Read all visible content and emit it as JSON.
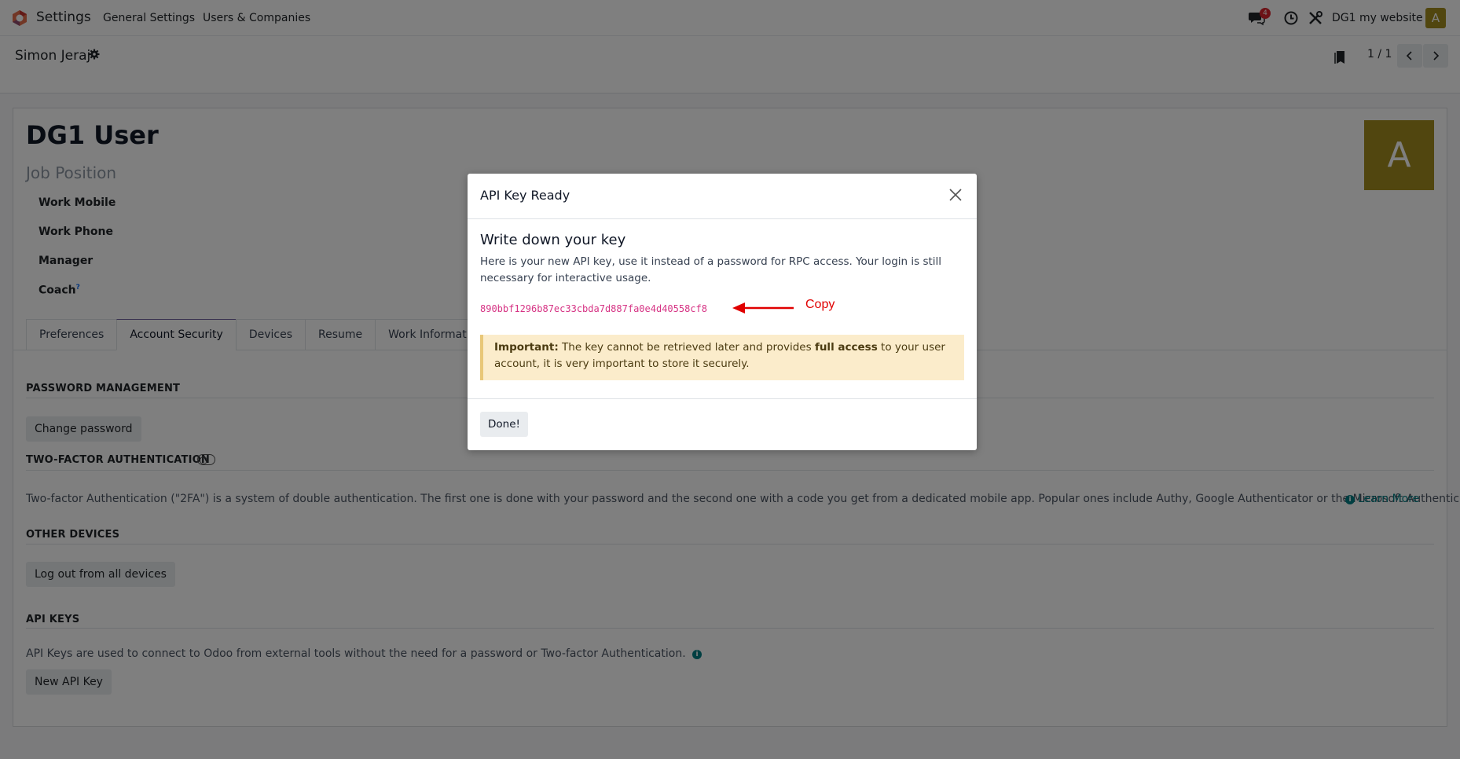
{
  "navbar": {
    "app_name": "Settings",
    "menu": [
      "General Settings",
      "Users & Companies"
    ],
    "chat_badge": "4",
    "company": "DG1 my website",
    "avatar_letter": "A"
  },
  "control_panel": {
    "breadcrumb": "Simon Jeraj",
    "pager": "1 / 1"
  },
  "form": {
    "title": "DG1 User",
    "job_position_placeholder": "Job Position",
    "fields": [
      "Work Mobile",
      "Work Phone",
      "Manager",
      "Coach"
    ],
    "coach_help": "?",
    "avatar_letter": "A",
    "tabs": [
      "Preferences",
      "Account Security",
      "Devices",
      "Resume",
      "Work Information"
    ],
    "active_tab": "Account Security",
    "sections": {
      "password": {
        "title": "PASSWORD MANAGEMENT",
        "button": "Change password"
      },
      "twofa": {
        "title": "TWO-FACTOR AUTHENTICATION",
        "description": "Two-factor Authentication (\"2FA\") is a system of double authentication. The first one is done with your password and the second one with a code you get from a dedicated mobile app. Popular ones include Authy, Google Authenticator or the Microsoft Authenticator.",
        "learn_more": "Learn More"
      },
      "devices": {
        "title": "OTHER DEVICES",
        "button": "Log out from all devices"
      },
      "api_keys": {
        "title": "API KEYS",
        "description": "API Keys are used to connect to Odoo from external tools without the need for a password or Two-factor Authentication.",
        "button": "New API Key"
      }
    }
  },
  "modal": {
    "title": "API Key Ready",
    "heading": "Write down your key",
    "description": "Here is your new API key, use it instead of a password for RPC access. Your login is still necessary for interactive usage.",
    "api_key": "890bbf1296b87ec33cbda7d887fa0e4d40558cf8",
    "annotation": "Copy",
    "warning_strong": "Important:",
    "warning_part1": " The key cannot be retrieved later and provides ",
    "warning_bold2": "full access",
    "warning_part2": " to your user account, it is very important to store it securely.",
    "done_button": "Done!"
  },
  "colors": {
    "avatar": "#a28c1f",
    "api_key": "#d63384",
    "annotation": "#e00000",
    "warning_bg": "#fbeccb"
  }
}
